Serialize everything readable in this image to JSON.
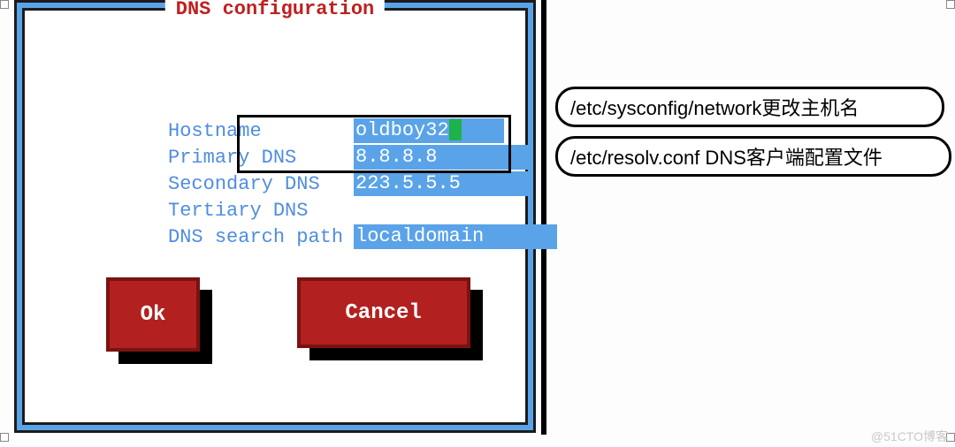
{
  "dialog": {
    "title": "DNS configuration",
    "fields": {
      "hostname": {
        "label": "Hostname",
        "value": "oldboy32"
      },
      "primary_dns": {
        "label": "Primary DNS",
        "value": "8.8.8.8"
      },
      "secondary_dns": {
        "label": "Secondary DNS",
        "value": "223.5.5.5"
      },
      "tertiary_dns": {
        "label": "Tertiary DNS",
        "value": ""
      },
      "search_path": {
        "label": "DNS search path",
        "value": "localdomain"
      }
    },
    "buttons": {
      "ok": "Ok",
      "cancel": "Cancel"
    }
  },
  "notes": {
    "network": "/etc/sysconfig/network更改主机名",
    "resolv": "/etc/resolv.conf DNS客户端配置文件"
  },
  "watermark": "@51CTO博客"
}
